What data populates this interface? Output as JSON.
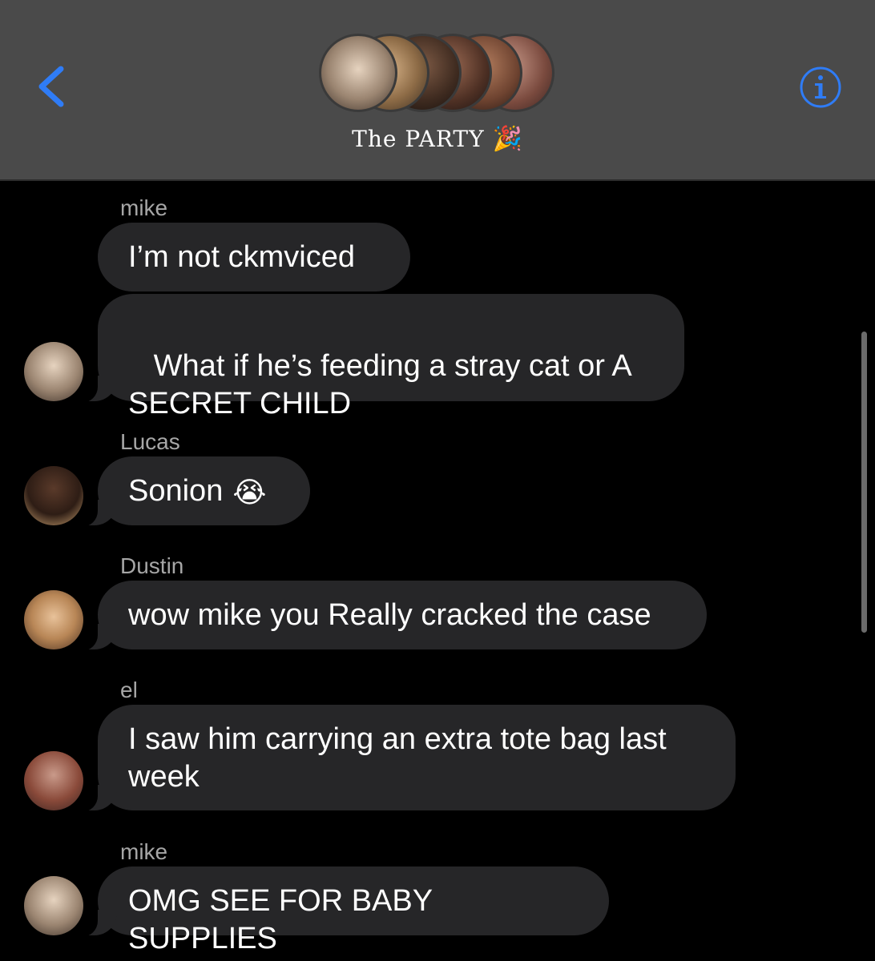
{
  "header": {
    "group_name": "The PARTY",
    "group_emoji": "🎉",
    "back_icon": "chevron-left-icon",
    "info_icon": "info-icon",
    "accent": "#2f7cf6"
  },
  "messages": [
    {
      "sender": "mike",
      "text": "I’m not ckmviced"
    },
    {
      "text": " What if he’s feeding a stray cat or A SECRET CHILD"
    },
    {
      "sender": "Lucas",
      "text": "Sonion",
      "emoji": "😭"
    },
    {
      "sender": "Dustin",
      "text": "wow mike you Really cracked the case"
    },
    {
      "sender": "el",
      "text": "I saw him carrying an extra tote bag last week"
    },
    {
      "sender": "mike",
      "text": "OMG SEE FOR BABY SUPPLIES"
    }
  ]
}
